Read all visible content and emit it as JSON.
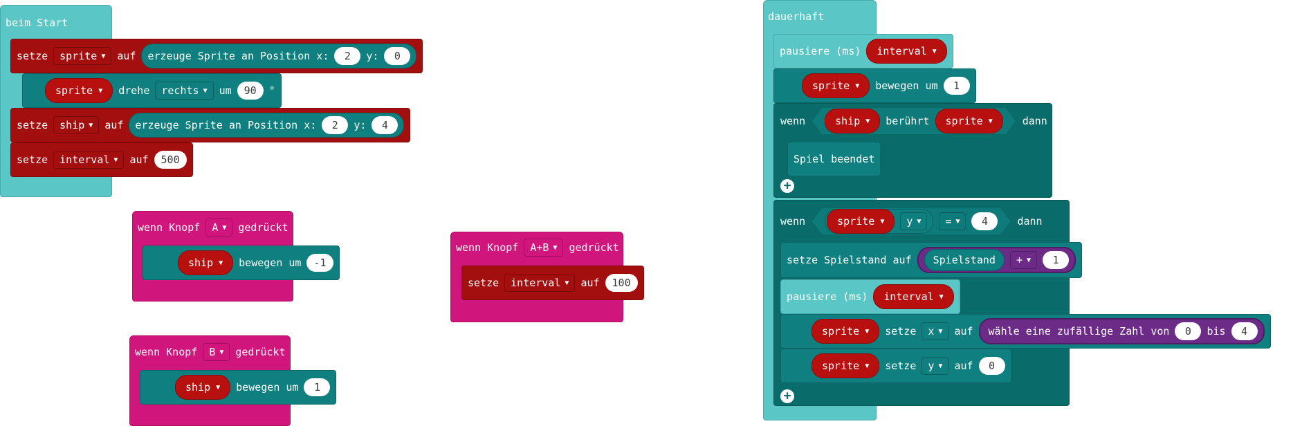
{
  "colors": {
    "loops": "#5bc6c6",
    "input": "#d0157c",
    "variables": "#a30f0f",
    "game": "#0f7f7f",
    "math": "#6b2b86"
  },
  "on_start": {
    "label": "beim Start",
    "set_sprite": {
      "set": "setze",
      "var": "sprite",
      "to": "auf",
      "create": "erzeuge Sprite an Position x:",
      "x": "2",
      "y_label": "y:",
      "y": "0"
    },
    "turn": {
      "var": "sprite",
      "verb": "drehe",
      "dir": "rechts",
      "by": "um",
      "deg": "90",
      "unit": "°"
    },
    "set_ship": {
      "set": "setze",
      "var": "ship",
      "to": "auf",
      "create": "erzeuge Sprite an Position x:",
      "x": "2",
      "y_label": "y:",
      "y": "4"
    },
    "set_interval": {
      "set": "setze",
      "var": "interval",
      "to": "auf",
      "value": "500"
    }
  },
  "btn_a": {
    "when": "wenn Knopf",
    "button": "A",
    "pressed": "gedrückt",
    "var": "ship",
    "move": "bewegen um",
    "value": "-1"
  },
  "btn_b": {
    "when": "wenn Knopf",
    "button": "B",
    "pressed": "gedrückt",
    "var": "ship",
    "move": "bewegen um",
    "value": "1"
  },
  "btn_ab": {
    "when": "wenn Knopf",
    "button": "A+B",
    "pressed": "gedrückt",
    "set": "setze",
    "var": "interval",
    "to": "auf",
    "value": "100"
  },
  "forever": {
    "label": "dauerhaft",
    "pause1": {
      "label": "pausiere (ms)",
      "var": "interval"
    },
    "move": {
      "var": "sprite",
      "move": "bewegen um",
      "value": "1"
    },
    "if1": {
      "if": "wenn",
      "a": "ship",
      "touch": "berührt",
      "b": "sprite",
      "then": "dann",
      "body": "Spiel beendet"
    },
    "if2": {
      "if": "wenn",
      "var": "sprite",
      "prop": "y",
      "op": "=",
      "value": "4",
      "then": "dann",
      "score": {
        "label": "setze Spielstand auf",
        "score": "Spielstand",
        "op": "+",
        "value": "1"
      },
      "pause": {
        "label": "pausiere (ms)",
        "var": "interval"
      },
      "setx": {
        "var": "sprite",
        "set": "setze",
        "prop": "x",
        "to": "auf",
        "random": "wähle eine zufällige Zahl von",
        "from": "0",
        "between": "bis",
        "upto": "4"
      },
      "sety": {
        "var": "sprite",
        "set": "setze",
        "prop": "y",
        "to": "auf",
        "value": "0"
      }
    }
  }
}
